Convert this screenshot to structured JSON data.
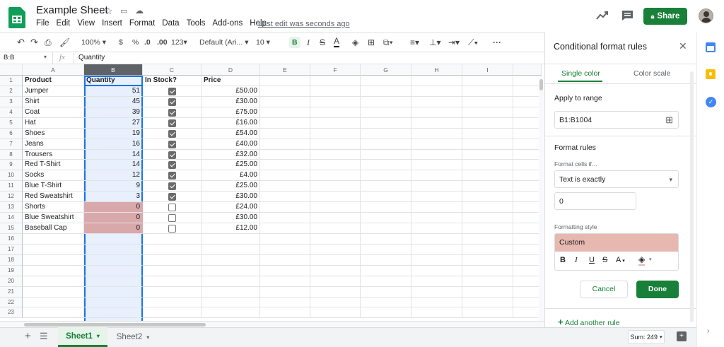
{
  "header": {
    "doc_title": "Example Sheet",
    "menus": [
      "File",
      "Edit",
      "View",
      "Insert",
      "Format",
      "Data",
      "Tools",
      "Add-ons",
      "Help"
    ],
    "last_edit": "Last edit was seconds ago",
    "share_label": "Share"
  },
  "toolbar": {
    "zoom": "100%",
    "currency": "$",
    "percent": "%",
    "dec_decrease": ".0",
    "dec_increase": ".00",
    "number_format": "123",
    "font": "Default (Ari...",
    "font_size": "10",
    "bold": "B",
    "italic": "I",
    "strike": "S",
    "text_color": "A",
    "more": "···"
  },
  "formula_bar": {
    "name_box": "B:B",
    "fx": "fx",
    "value": "Quantity"
  },
  "grid": {
    "columns": [
      "A",
      "B",
      "C",
      "D",
      "E",
      "F",
      "G",
      "H",
      "I"
    ],
    "row_numbers": [
      "1",
      "2",
      "3",
      "4",
      "5",
      "6",
      "7",
      "8",
      "9",
      "10",
      "11",
      "12",
      "13",
      "14",
      "15",
      "16",
      "17",
      "18",
      "19",
      "20",
      "21",
      "22",
      "23"
    ],
    "header_row": {
      "product": "Product",
      "quantity": "Quantity",
      "in_stock": "In Stock?",
      "price": "Price"
    },
    "rows": [
      {
        "product": "Jumper",
        "quantity": "51",
        "in_stock": true,
        "price": "£50.00"
      },
      {
        "product": "Shirt",
        "quantity": "45",
        "in_stock": true,
        "price": "£30.00"
      },
      {
        "product": "Coat",
        "quantity": "39",
        "in_stock": true,
        "price": "£75.00"
      },
      {
        "product": "Hat",
        "quantity": "27",
        "in_stock": true,
        "price": "£16.00"
      },
      {
        "product": "Shoes",
        "quantity": "19",
        "in_stock": true,
        "price": "£54.00"
      },
      {
        "product": "Jeans",
        "quantity": "16",
        "in_stock": true,
        "price": "£40.00"
      },
      {
        "product": "Trousers",
        "quantity": "14",
        "in_stock": true,
        "price": "£32.00"
      },
      {
        "product": "Red T-Shirt",
        "quantity": "14",
        "in_stock": true,
        "price": "£25.00"
      },
      {
        "product": "Socks",
        "quantity": "12",
        "in_stock": true,
        "price": "£4.00"
      },
      {
        "product": "Blue T-Shirt",
        "quantity": "9",
        "in_stock": true,
        "price": "£25.00"
      },
      {
        "product": "Red Sweatshirt",
        "quantity": "3",
        "in_stock": true,
        "price": "£30.00"
      },
      {
        "product": "Shorts",
        "quantity": "0",
        "in_stock": false,
        "price": "£24.00"
      },
      {
        "product": "Blue Sweatshirt",
        "quantity": "0",
        "in_stock": false,
        "price": "£30.00"
      },
      {
        "product": "Baseball Cap",
        "quantity": "0",
        "in_stock": false,
        "price": "£12.00"
      }
    ]
  },
  "colors": {
    "accent": "#188038",
    "selected_col": "#e8f0fe",
    "highlight": "#d9a8ab",
    "select_border": "#1a73e8"
  },
  "sheet_tabs": {
    "sheet1": "Sheet1",
    "sheet2": "Sheet2"
  },
  "sum_label": "Sum: 249",
  "panel": {
    "title": "Conditional format rules",
    "tab_single": "Single color",
    "tab_scale": "Color scale",
    "apply_label": "Apply to range",
    "range": "B1:B1004",
    "format_rules": "Format rules",
    "format_cells_if": "Format cells if…",
    "condition": "Text is exactly",
    "value": "0",
    "formatting_style": "Formatting style",
    "custom": "Custom",
    "style_b": "B",
    "style_i": "I",
    "style_u": "U",
    "style_s": "S",
    "style_a": "A",
    "cancel": "Cancel",
    "done": "Done",
    "add_rule": "Add another rule"
  }
}
